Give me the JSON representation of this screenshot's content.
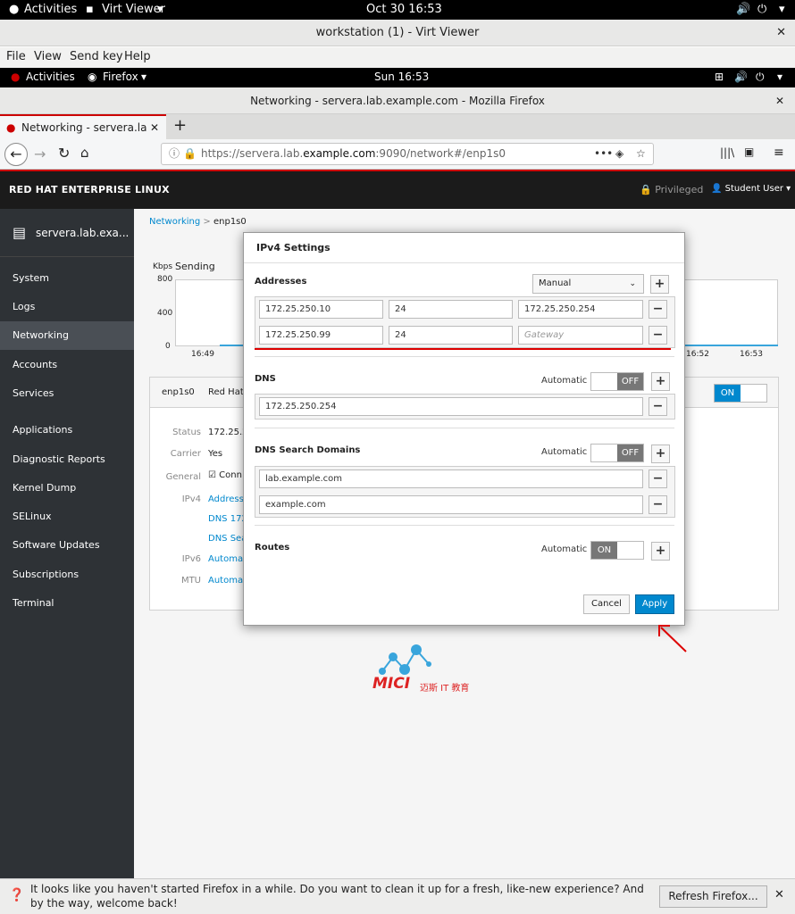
{
  "gnome_host": {
    "activities": "Activities",
    "app": "Virt Viewer",
    "clock": "Oct 30  16:53"
  },
  "virt_window": {
    "title": "workstation (1) - Virt Viewer",
    "menu": [
      "File",
      "View",
      "Send key",
      "Help"
    ]
  },
  "gnome_guest": {
    "activities": "Activities",
    "app": "Firefox",
    "clock": "Sun 16:53"
  },
  "firefox": {
    "window_title": "Networking - servera.lab.example.com - Mozilla Firefox",
    "tab_title": "Networking - servera.lab.",
    "new_tab": "+",
    "url_prefix": "https://servera.lab.",
    "url_domain": "example.com",
    "url_suffix": ":9090/network#/enp1s0"
  },
  "cockpit": {
    "brand": "RED HAT ENTERPRISE LINUX",
    "privileged": "Privileged",
    "user": "Student User",
    "host": "servera.lab.exa...",
    "nav": [
      "System",
      "Logs",
      "Networking",
      "Accounts",
      "Services",
      "Applications",
      "Diagnostic Reports",
      "Kernel Dump",
      "SELinux",
      "Software Updates",
      "Subscriptions",
      "Terminal"
    ],
    "active_nav": "Networking",
    "breadcrumb_root": "Networking",
    "breadcrumb_sep": ">",
    "breadcrumb_current": "enp1s0",
    "chart": {
      "unit": "Kbps",
      "series": "Sending",
      "y_ticks": [
        "800",
        "400",
        "0"
      ],
      "x_ticks_left": [
        "16:49"
      ],
      "x_ticks_right": [
        "16:52",
        "16:53"
      ]
    },
    "iface": {
      "name": "enp1s0",
      "vendor": "Red Hat,",
      "toggle": "ON",
      "rows": [
        {
          "label": "Status",
          "value": "172.25.2"
        },
        {
          "label": "Carrier",
          "value": "Yes"
        },
        {
          "label": "General",
          "value": "Conn"
        },
        {
          "label": "IPv4",
          "value": "Address"
        },
        {
          "label": "",
          "value": "DNS 172"
        },
        {
          "label": "",
          "value": "DNS Sea"
        },
        {
          "label": "IPv6",
          "value": "Automat"
        },
        {
          "label": "MTU",
          "value": "Automat"
        }
      ]
    }
  },
  "modal": {
    "title": "IPv4 Settings",
    "addresses": {
      "label": "Addresses",
      "mode": "Manual",
      "rows": [
        {
          "address": "172.25.250.10",
          "prefix": "24",
          "gateway": "172.25.250.254",
          "gateway_placeholder": ""
        },
        {
          "address": "172.25.250.99",
          "prefix": "24",
          "gateway": "",
          "gateway_placeholder": "Gateway"
        }
      ]
    },
    "dns": {
      "label": "DNS",
      "auto_label": "Automatic",
      "toggle": "OFF",
      "servers": [
        "172.25.250.254"
      ]
    },
    "dns_search": {
      "label": "DNS Search Domains",
      "auto_label": "Automatic",
      "toggle": "OFF",
      "domains": [
        "lab.example.com",
        "example.com"
      ]
    },
    "routes": {
      "label": "Routes",
      "auto_label": "Automatic",
      "toggle": "ON"
    },
    "cancel": "Cancel",
    "apply": "Apply"
  },
  "watermark": {
    "brand": "MICI",
    "sub": "迈斯 IT 教育"
  },
  "notification": {
    "text": "It looks like you haven't started Firefox in a while. Do you want to clean it up for a fresh, like-new experience? And by the way, welcome back!",
    "button": "Refresh Firefox..."
  },
  "colors": {
    "accent_red": "#cc0000",
    "apply_blue": "#0088ce",
    "sidebar": "#2e3236"
  }
}
